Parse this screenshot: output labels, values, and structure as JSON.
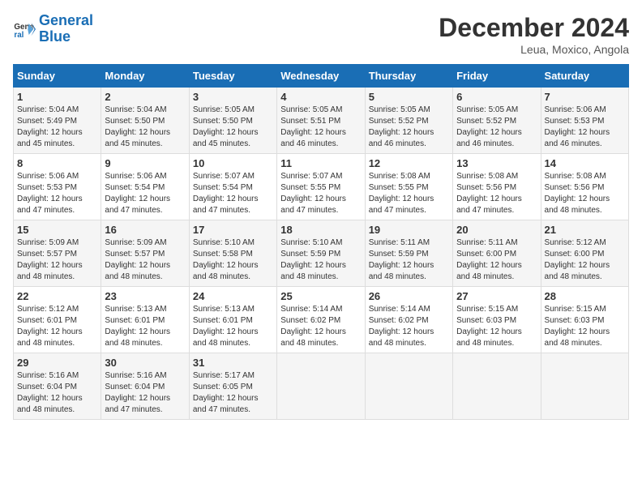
{
  "logo": {
    "line1": "General",
    "line2": "Blue"
  },
  "title": "December 2024",
  "location": "Leua, Moxico, Angola",
  "weekdays": [
    "Sunday",
    "Monday",
    "Tuesday",
    "Wednesday",
    "Thursday",
    "Friday",
    "Saturday"
  ],
  "weeks": [
    [
      {
        "day": 1,
        "sunrise": "5:04 AM",
        "sunset": "5:49 PM",
        "daylight": "12 hours and 45 minutes."
      },
      {
        "day": 2,
        "sunrise": "5:04 AM",
        "sunset": "5:50 PM",
        "daylight": "12 hours and 45 minutes."
      },
      {
        "day": 3,
        "sunrise": "5:05 AM",
        "sunset": "5:50 PM",
        "daylight": "12 hours and 45 minutes."
      },
      {
        "day": 4,
        "sunrise": "5:05 AM",
        "sunset": "5:51 PM",
        "daylight": "12 hours and 46 minutes."
      },
      {
        "day": 5,
        "sunrise": "5:05 AM",
        "sunset": "5:52 PM",
        "daylight": "12 hours and 46 minutes."
      },
      {
        "day": 6,
        "sunrise": "5:05 AM",
        "sunset": "5:52 PM",
        "daylight": "12 hours and 46 minutes."
      },
      {
        "day": 7,
        "sunrise": "5:06 AM",
        "sunset": "5:53 PM",
        "daylight": "12 hours and 46 minutes."
      }
    ],
    [
      {
        "day": 8,
        "sunrise": "5:06 AM",
        "sunset": "5:53 PM",
        "daylight": "12 hours and 47 minutes."
      },
      {
        "day": 9,
        "sunrise": "5:06 AM",
        "sunset": "5:54 PM",
        "daylight": "12 hours and 47 minutes."
      },
      {
        "day": 10,
        "sunrise": "5:07 AM",
        "sunset": "5:54 PM",
        "daylight": "12 hours and 47 minutes."
      },
      {
        "day": 11,
        "sunrise": "5:07 AM",
        "sunset": "5:55 PM",
        "daylight": "12 hours and 47 minutes."
      },
      {
        "day": 12,
        "sunrise": "5:08 AM",
        "sunset": "5:55 PM",
        "daylight": "12 hours and 47 minutes."
      },
      {
        "day": 13,
        "sunrise": "5:08 AM",
        "sunset": "5:56 PM",
        "daylight": "12 hours and 47 minutes."
      },
      {
        "day": 14,
        "sunrise": "5:08 AM",
        "sunset": "5:56 PM",
        "daylight": "12 hours and 48 minutes."
      }
    ],
    [
      {
        "day": 15,
        "sunrise": "5:09 AM",
        "sunset": "5:57 PM",
        "daylight": "12 hours and 48 minutes."
      },
      {
        "day": 16,
        "sunrise": "5:09 AM",
        "sunset": "5:57 PM",
        "daylight": "12 hours and 48 minutes."
      },
      {
        "day": 17,
        "sunrise": "5:10 AM",
        "sunset": "5:58 PM",
        "daylight": "12 hours and 48 minutes."
      },
      {
        "day": 18,
        "sunrise": "5:10 AM",
        "sunset": "5:59 PM",
        "daylight": "12 hours and 48 minutes."
      },
      {
        "day": 19,
        "sunrise": "5:11 AM",
        "sunset": "5:59 PM",
        "daylight": "12 hours and 48 minutes."
      },
      {
        "day": 20,
        "sunrise": "5:11 AM",
        "sunset": "6:00 PM",
        "daylight": "12 hours and 48 minutes."
      },
      {
        "day": 21,
        "sunrise": "5:12 AM",
        "sunset": "6:00 PM",
        "daylight": "12 hours and 48 minutes."
      }
    ],
    [
      {
        "day": 22,
        "sunrise": "5:12 AM",
        "sunset": "6:01 PM",
        "daylight": "12 hours and 48 minutes."
      },
      {
        "day": 23,
        "sunrise": "5:13 AM",
        "sunset": "6:01 PM",
        "daylight": "12 hours and 48 minutes."
      },
      {
        "day": 24,
        "sunrise": "5:13 AM",
        "sunset": "6:01 PM",
        "daylight": "12 hours and 48 minutes."
      },
      {
        "day": 25,
        "sunrise": "5:14 AM",
        "sunset": "6:02 PM",
        "daylight": "12 hours and 48 minutes."
      },
      {
        "day": 26,
        "sunrise": "5:14 AM",
        "sunset": "6:02 PM",
        "daylight": "12 hours and 48 minutes."
      },
      {
        "day": 27,
        "sunrise": "5:15 AM",
        "sunset": "6:03 PM",
        "daylight": "12 hours and 48 minutes."
      },
      {
        "day": 28,
        "sunrise": "5:15 AM",
        "sunset": "6:03 PM",
        "daylight": "12 hours and 48 minutes."
      }
    ],
    [
      {
        "day": 29,
        "sunrise": "5:16 AM",
        "sunset": "6:04 PM",
        "daylight": "12 hours and 48 minutes."
      },
      {
        "day": 30,
        "sunrise": "5:16 AM",
        "sunset": "6:04 PM",
        "daylight": "12 hours and 47 minutes."
      },
      {
        "day": 31,
        "sunrise": "5:17 AM",
        "sunset": "6:05 PM",
        "daylight": "12 hours and 47 minutes."
      },
      null,
      null,
      null,
      null
    ]
  ]
}
